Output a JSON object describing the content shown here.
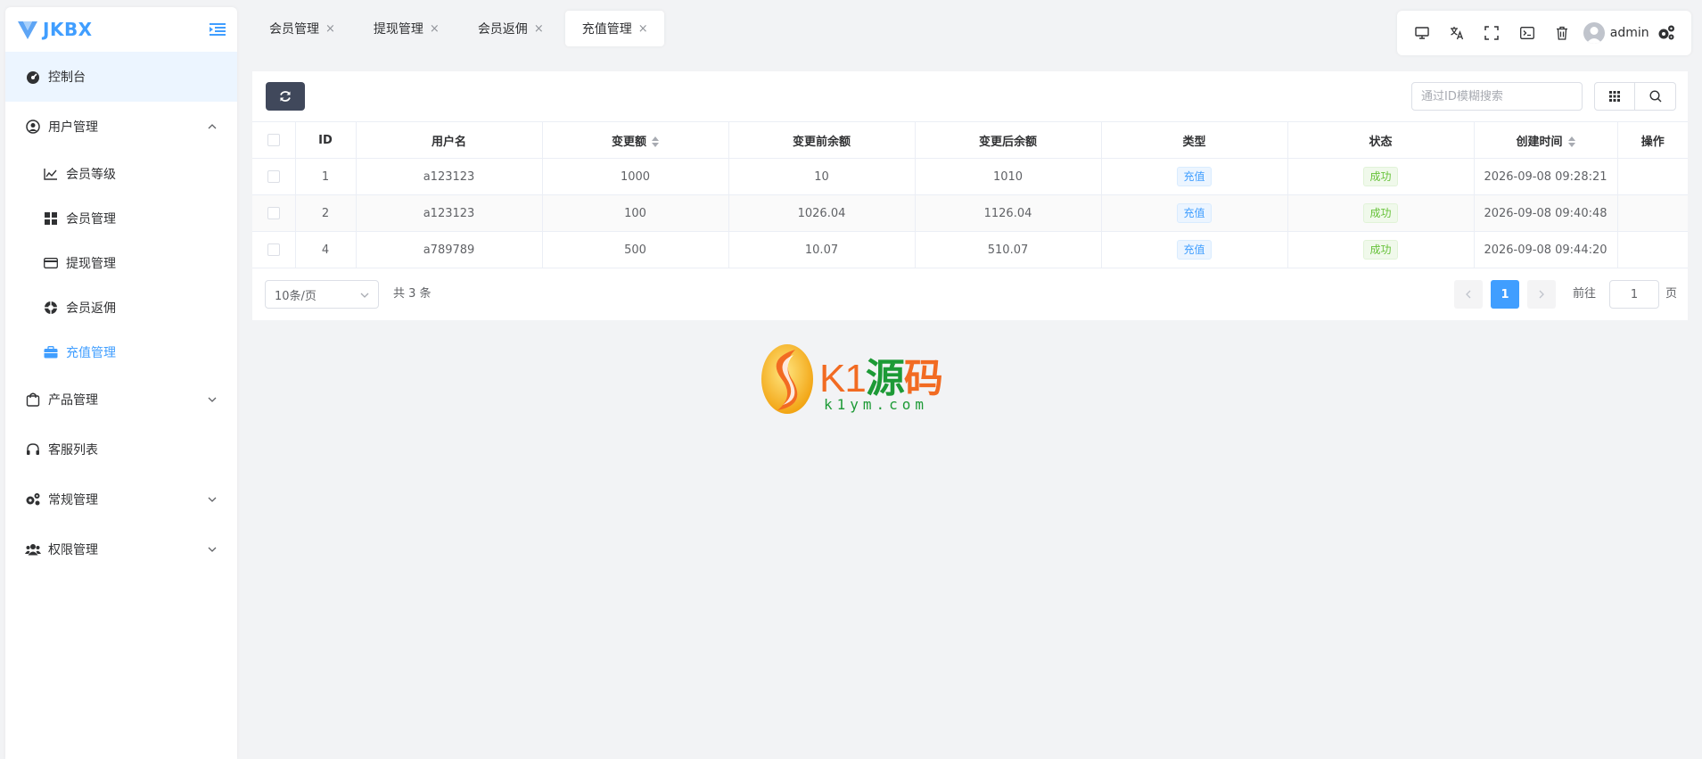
{
  "brand": {
    "name": "JKBX"
  },
  "sidebar": {
    "dashboard": "控制台",
    "user_mgmt": "用户管理",
    "sub_items": [
      {
        "label": "会员等级",
        "icon": "chart-line-icon"
      },
      {
        "label": "会员管理",
        "icon": "grid-icon"
      },
      {
        "label": "提现管理",
        "icon": "credit-card-icon"
      },
      {
        "label": "会员返佣",
        "icon": "life-ring-icon"
      },
      {
        "label": "充值管理",
        "icon": "briefcase-icon"
      }
    ],
    "product_mgmt": "产品管理",
    "service_list": "客服列表",
    "general_mgmt": "常规管理",
    "auth_mgmt": "权限管理"
  },
  "tabs": [
    {
      "label": "会员管理",
      "close": "×"
    },
    {
      "label": "提现管理",
      "close": "×"
    },
    {
      "label": "会员返佣",
      "close": "×"
    },
    {
      "label": "充值管理",
      "close": "×"
    }
  ],
  "toolbar": {
    "username": "admin"
  },
  "search": {
    "placeholder": "通过ID模糊搜索"
  },
  "table": {
    "headers": [
      "ID",
      "用户名",
      "变更额",
      "变更前余额",
      "变更后余额",
      "类型",
      "状态",
      "创建时间",
      "操作"
    ],
    "rows": [
      {
        "id": "1",
        "username": "a123123",
        "amount": "1000",
        "before": "10",
        "after": "1010",
        "type": "充值",
        "status": "成功",
        "created": "2026-09-08 09:28:21"
      },
      {
        "id": "2",
        "username": "a123123",
        "amount": "100",
        "before": "1026.04",
        "after": "1126.04",
        "type": "充值",
        "status": "成功",
        "created": "2026-09-08 09:40:48"
      },
      {
        "id": "4",
        "username": "a789789",
        "amount": "500",
        "before": "10.07",
        "after": "510.07",
        "type": "充值",
        "status": "成功",
        "created": "2026-09-08 09:44:20"
      }
    ]
  },
  "pager": {
    "page_size": "10条/页",
    "total": "共 3 条",
    "current": "1",
    "goto_label": "前往",
    "goto_value": "1",
    "goto_suffix": "页"
  },
  "watermark": {
    "text_latin": "K1",
    "text_cn1": "源",
    "text_cn2": "码",
    "url": "k1ym.com"
  },
  "colors": {
    "accent": "#409eff",
    "dark_button": "#40485b",
    "success": "#67c23a"
  }
}
